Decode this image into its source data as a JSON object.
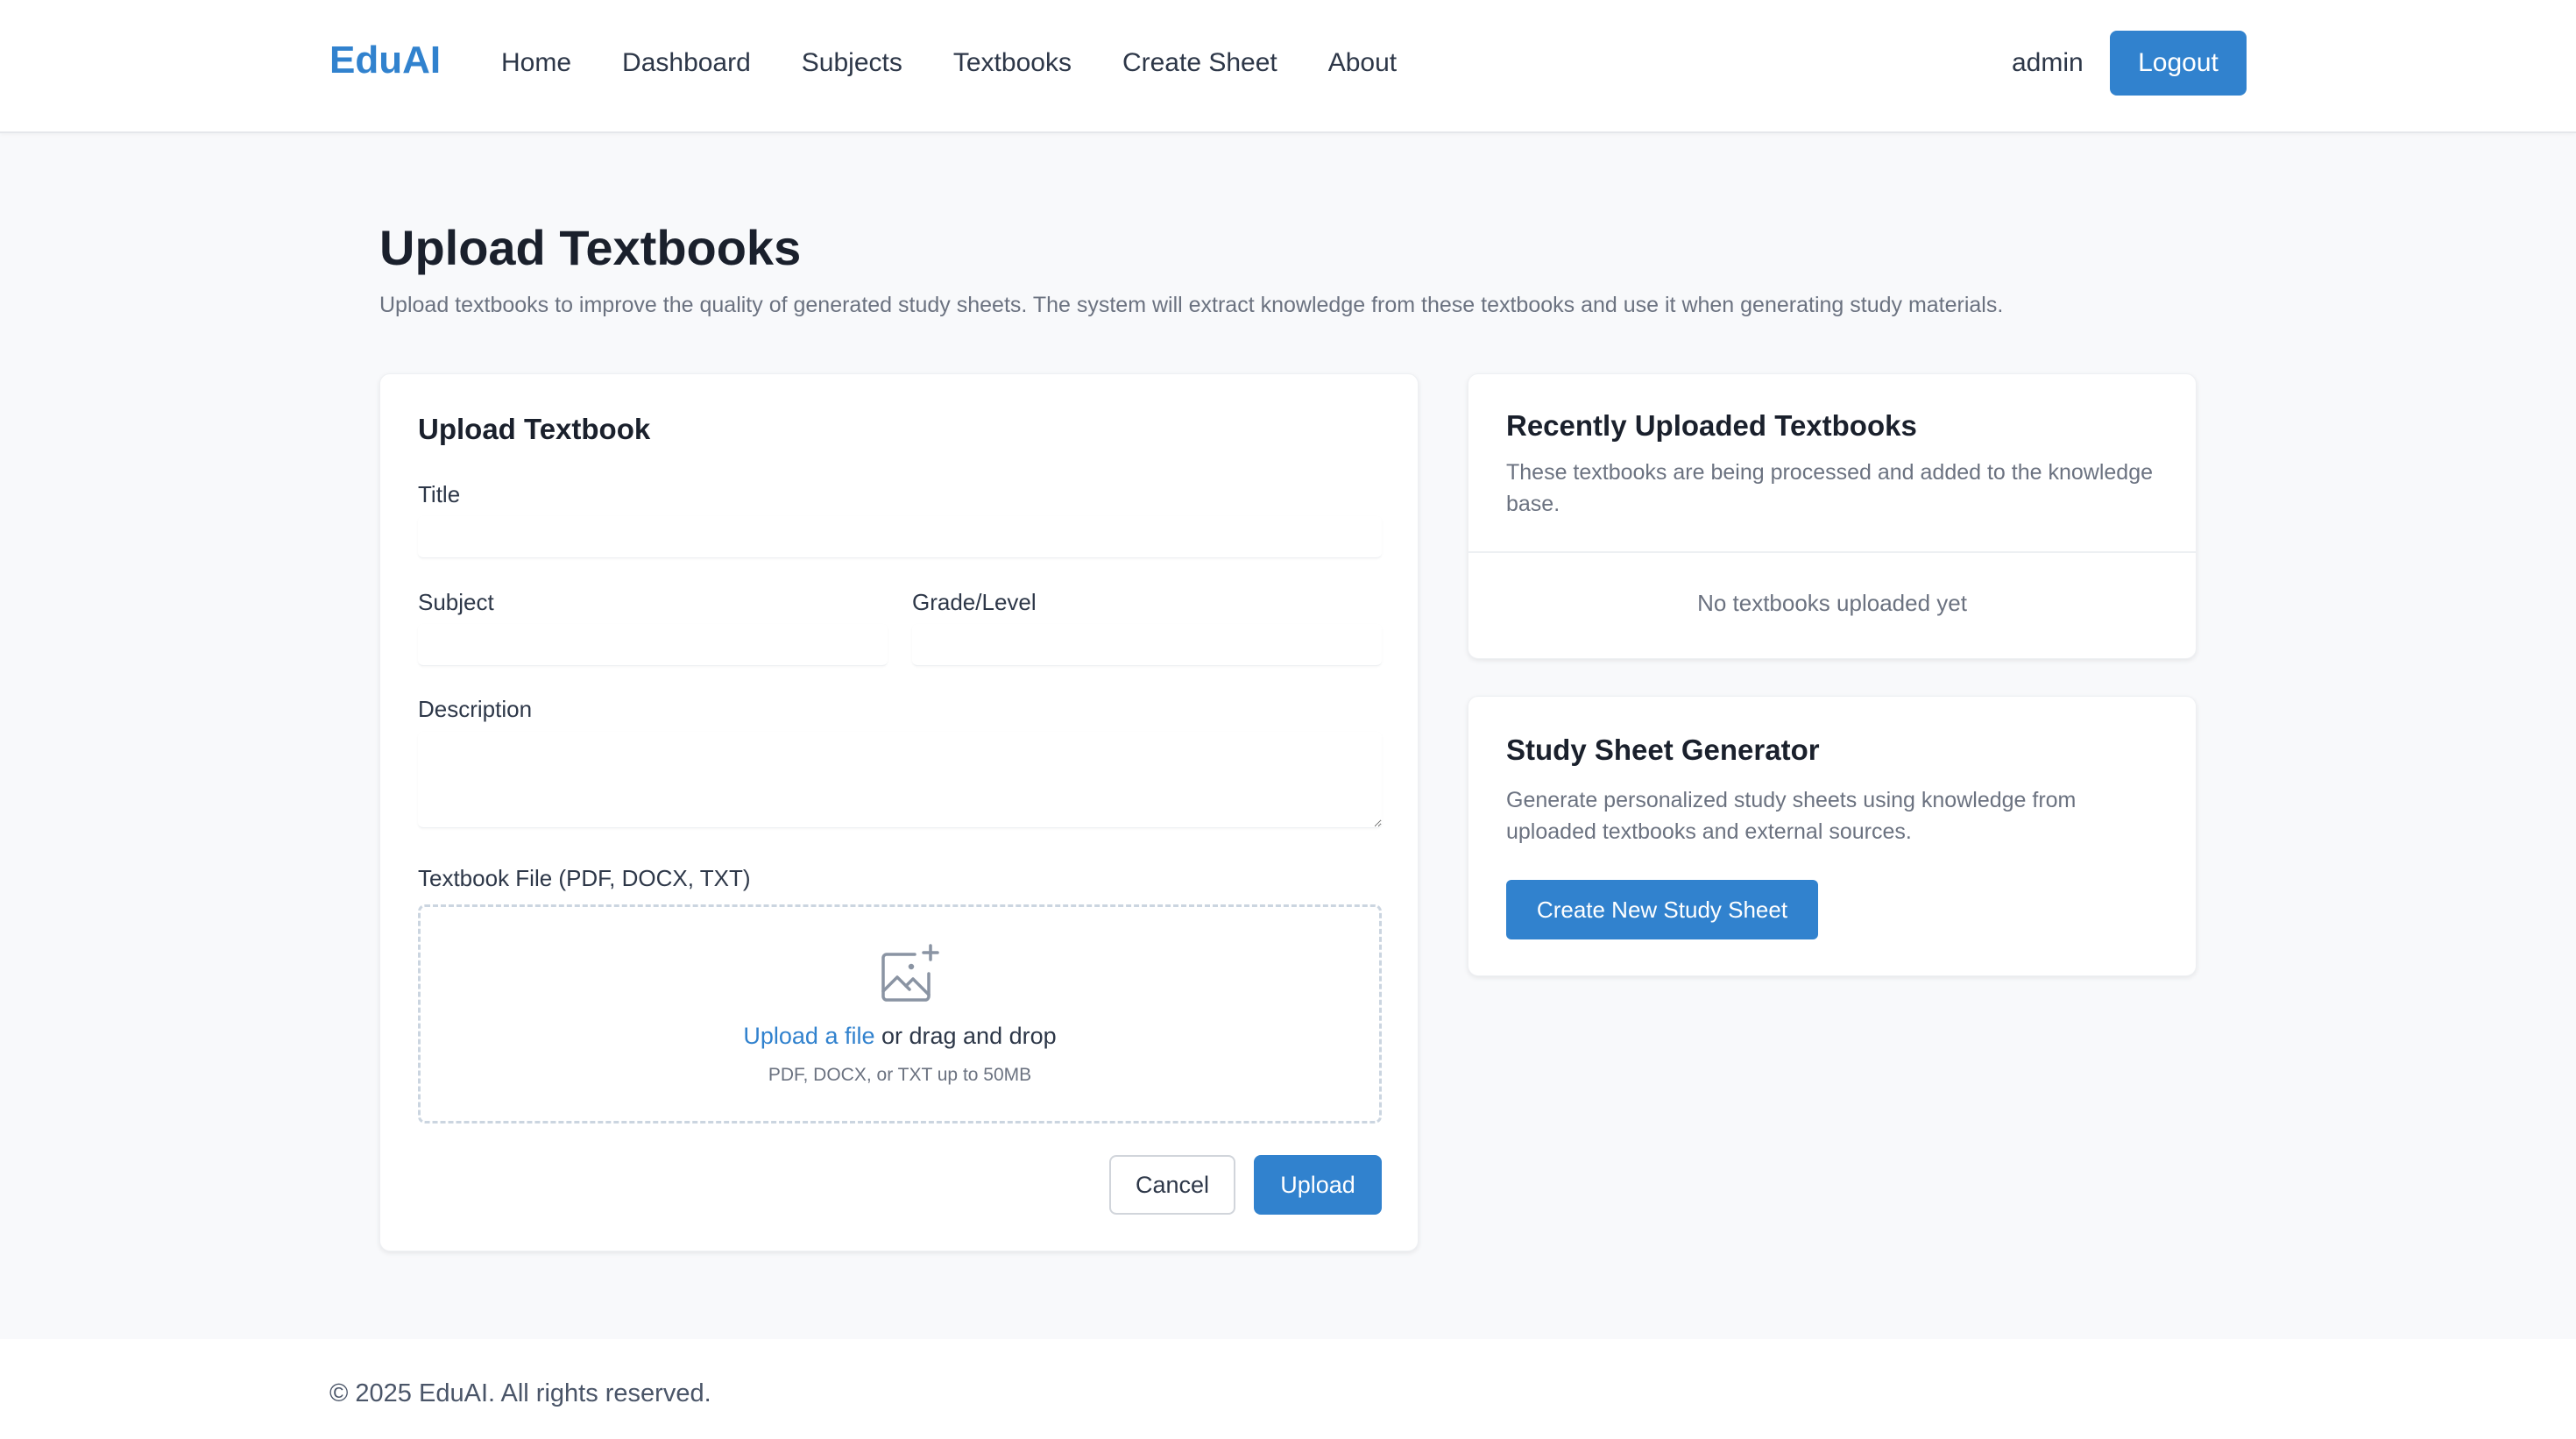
{
  "nav": {
    "brand": "EduAI",
    "links": [
      "Home",
      "Dashboard",
      "Subjects",
      "Textbooks",
      "Create Sheet",
      "About"
    ],
    "user": "admin",
    "logout_label": "Logout"
  },
  "page": {
    "title": "Upload Textbooks",
    "subtitle": "Upload textbooks to improve the quality of generated study sheets. The system will extract knowledge from these textbooks and use it when generating study materials."
  },
  "upload_form": {
    "title": "Upload Textbook",
    "title_label": "Title",
    "title_value": "",
    "subject_label": "Subject",
    "subject_value": "",
    "grade_label": "Grade/Level",
    "grade_value": "",
    "description_label": "Description",
    "description_value": "",
    "file_label": "Textbook File (PDF, DOCX, TXT)",
    "dropzone_link": "Upload a file",
    "dropzone_text": " or drag and drop",
    "dropzone_hint": "PDF, DOCX, or TXT up to 50MB",
    "dropzone_icon": "image-plus-icon",
    "cancel_label": "Cancel",
    "upload_label": "Upload"
  },
  "recent": {
    "title": "Recently Uploaded Textbooks",
    "description": "These textbooks are being processed and added to the knowledge base.",
    "empty_text": "No textbooks uploaded yet"
  },
  "generator": {
    "title": "Study Sheet Generator",
    "description": "Generate personalized study sheets using knowledge from uploaded textbooks and external sources.",
    "button_label": "Create New Study Sheet"
  },
  "footer": {
    "text": "© 2025 EduAI. All rights reserved."
  },
  "colors": {
    "accent": "#3182ce",
    "background": "#f8f9fb",
    "text_muted": "#6b7280"
  }
}
